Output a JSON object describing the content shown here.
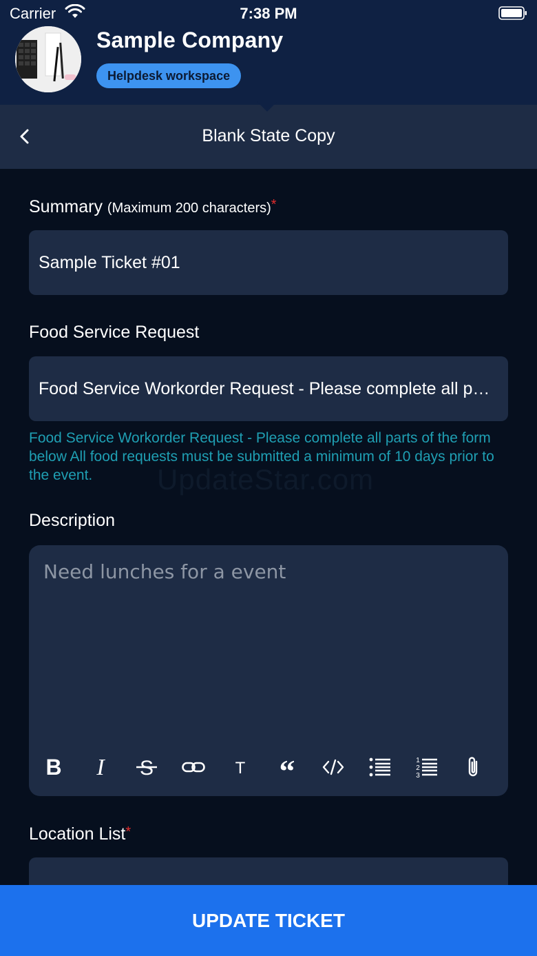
{
  "status_bar": {
    "carrier": "Carrier",
    "time": "7:38 PM"
  },
  "header": {
    "company_name": "Sample Company",
    "workspace_badge": "Helpdesk workspace"
  },
  "nav": {
    "title": "Blank State Copy"
  },
  "form": {
    "summary": {
      "label": "Summary",
      "note": "(Maximum 200 characters)",
      "required_mark": "*",
      "value": "Sample Ticket #01"
    },
    "food_service": {
      "label": "Food Service Request",
      "value": "Food Service Workorder Request - Please complete all parts of the form below All food requests must be submitted a minimum of 10 days prior to the event.",
      "helper": "Food Service Workorder Request - Please complete all parts of the form below All food requests must be submitted a minimum of 10 days prior to the event."
    },
    "description": {
      "label": "Description",
      "placeholder": "Need lunches for a event",
      "toolbar": [
        "bold-icon",
        "italic-icon",
        "strikethrough-icon",
        "link-icon",
        "text-style-icon",
        "quote-icon",
        "code-icon",
        "bulleted-list-icon",
        "numbered-list-icon",
        "attachment-icon"
      ]
    },
    "location": {
      "label": "Location List",
      "required_mark": "*"
    }
  },
  "watermark": "UpdateStar.com",
  "actions": {
    "update_label": "UPDATE TICKET"
  },
  "colors": {
    "header_bg": "#0f2143",
    "nav_bg": "#1e2c45",
    "page_bg": "#060f1e",
    "field_bg": "#1e2c45",
    "badge": "#3d93f0",
    "helper_text": "#1f9fb3",
    "required": "#e22d2d",
    "primary_button": "#1c71ed"
  }
}
